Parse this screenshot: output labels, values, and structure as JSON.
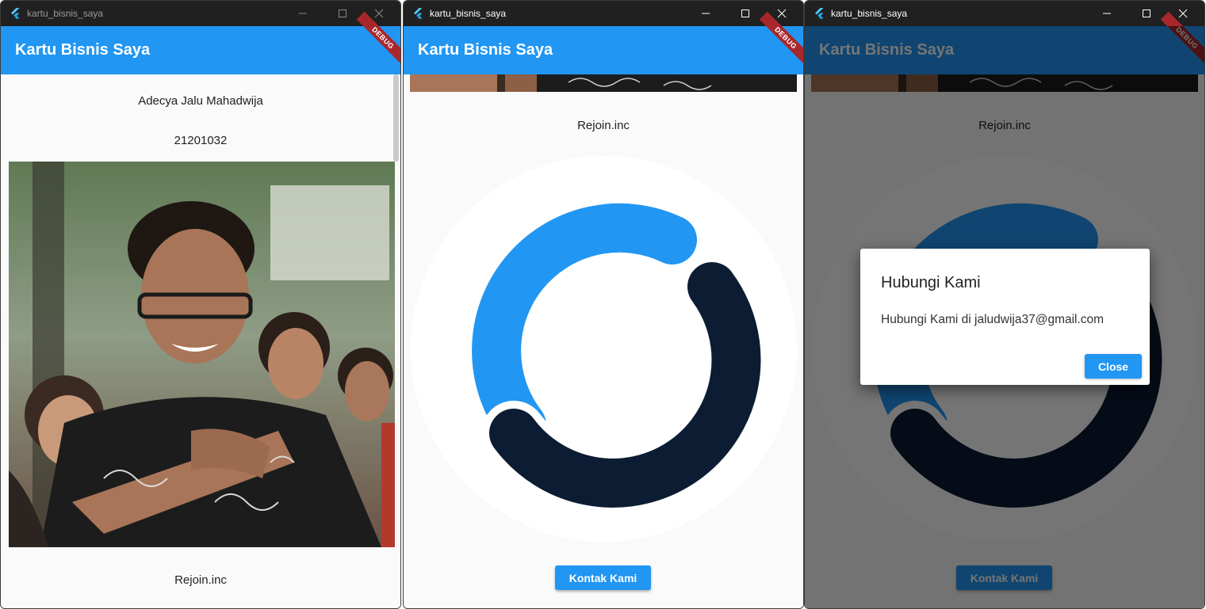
{
  "window_title": "kartu_bisnis_saya",
  "app_bar": {
    "title": "Kartu Bisnis Saya",
    "debug_banner": "DEBUG"
  },
  "window_controls": {
    "minimize_icon": "minimize-icon",
    "maximize_icon": "maximize-icon",
    "close_icon": "close-icon"
  },
  "colors": {
    "primary": "#2196f3",
    "logo_dark": "#0b1c33",
    "debug_banner": "#a8272a"
  },
  "profile": {
    "name": "Adecya Jalu Mahadwija",
    "student_id": "21201032",
    "company": "Rejoin.inc"
  },
  "contact_button_label": "Kontak Kami",
  "dialog": {
    "title": "Hubungi Kami",
    "content": "Hubungi Kami di jaludwija37@gmail.com",
    "close_label": "Close"
  }
}
